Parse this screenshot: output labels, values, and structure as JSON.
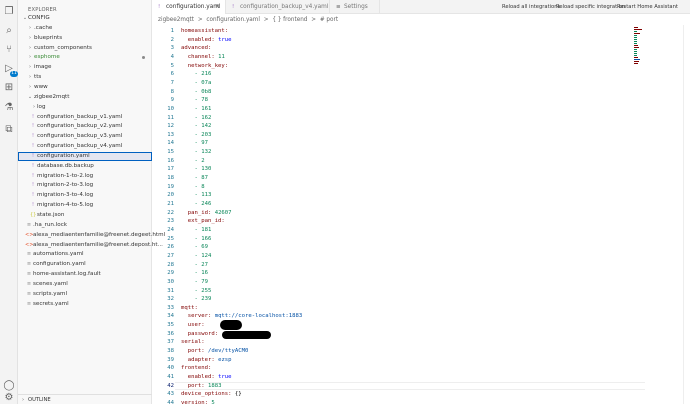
{
  "sidebar": {
    "title": "EXPLORER",
    "outline_label": "OUTLINE",
    "items": [
      {
        "label": "CONFIG",
        "type": "root"
      },
      {
        "label": ".cache",
        "type": "folder"
      },
      {
        "label": "blueprints",
        "type": "folder"
      },
      {
        "label": "custom_components",
        "type": "folder"
      },
      {
        "label": "esphome",
        "type": "folder-green"
      },
      {
        "label": "image",
        "type": "folder"
      },
      {
        "label": "tts",
        "type": "folder"
      },
      {
        "label": "www",
        "type": "folder"
      },
      {
        "label": "zigbee2mqtt",
        "type": "folder-open"
      },
      {
        "label": "log",
        "type": "subfolder"
      },
      {
        "label": "configuration_backup_v1.yaml",
        "type": "file"
      },
      {
        "label": "configuration_backup_v2.yaml",
        "type": "file"
      },
      {
        "label": "configuration_backup_v3.yaml",
        "type": "file"
      },
      {
        "label": "configuration_backup_v4.yaml",
        "type": "file"
      },
      {
        "label": "configuration.yaml",
        "type": "file-selected"
      },
      {
        "label": "database.db.backup",
        "type": "file"
      },
      {
        "label": "migration-1-to-2.log",
        "type": "file"
      },
      {
        "label": "migration-2-to-3.log",
        "type": "file"
      },
      {
        "label": "migration-3-to-4.log",
        "type": "file"
      },
      {
        "label": "migration-4-to-5.log",
        "type": "file"
      },
      {
        "label": "state.json",
        "type": "json"
      },
      {
        "label": ".ha_run.lock",
        "type": "rootfile"
      },
      {
        "label": "alexa_mediaentenfamilie@freenet.degeet.html",
        "type": "html"
      },
      {
        "label": "alexa_mediaentenfamilie@freenet.depost.ht...",
        "type": "html"
      },
      {
        "label": "automations.yaml",
        "type": "rootfile"
      },
      {
        "label": "configuration.yaml",
        "type": "rootfile"
      },
      {
        "label": "home-assistant.log.fault",
        "type": "rootfile"
      },
      {
        "label": "scenes.yaml",
        "type": "rootfile"
      },
      {
        "label": "scripts.yaml",
        "type": "rootfile"
      },
      {
        "label": "secrets.yaml",
        "type": "rootfile"
      }
    ]
  },
  "tabs": [
    {
      "label": "configuration.yaml",
      "active": true,
      "close": "×"
    },
    {
      "label": "configuration_backup_v4.yaml",
      "active": false,
      "close": ""
    },
    {
      "label": "Settings",
      "active": false,
      "close": ""
    }
  ],
  "header_actions": {
    "reload_all": "Reload all integrations",
    "reload_specific": "Reload specific integration",
    "restart": "Restart Home Assistant"
  },
  "breadcrumb": [
    "zigbee2mqtt",
    ">",
    "configuration.yaml",
    ">",
    "{ } frontend",
    ">",
    "# port"
  ],
  "editor": {
    "current_line": 42,
    "lines": [
      {
        "n": 1,
        "indent": "",
        "key": "homeassistant:",
        "val": "",
        "vtype": ""
      },
      {
        "n": 2,
        "indent": "  ",
        "key": "enabled:",
        "val": " true",
        "vtype": "b"
      },
      {
        "n": 3,
        "indent": "",
        "key": "advanced:",
        "val": "",
        "vtype": ""
      },
      {
        "n": 4,
        "indent": "  ",
        "key": "channel:",
        "val": " 11",
        "vtype": "n"
      },
      {
        "n": 5,
        "indent": "  ",
        "key": "network_key:",
        "val": "",
        "vtype": ""
      },
      {
        "n": 6,
        "indent": "    ",
        "key": "",
        "val": "- 216",
        "vtype": "n"
      },
      {
        "n": 7,
        "indent": "    ",
        "key": "",
        "val": "- 07a",
        "vtype": "n"
      },
      {
        "n": 8,
        "indent": "    ",
        "key": "",
        "val": "- 0b8",
        "vtype": "n"
      },
      {
        "n": 9,
        "indent": "    ",
        "key": "",
        "val": "- 78",
        "vtype": "n"
      },
      {
        "n": 10,
        "indent": "    ",
        "key": "",
        "val": "- 161",
        "vtype": "n"
      },
      {
        "n": 11,
        "indent": "    ",
        "key": "",
        "val": "- 162",
        "vtype": "n"
      },
      {
        "n": 12,
        "indent": "    ",
        "key": "",
        "val": "- 142",
        "vtype": "n"
      },
      {
        "n": 13,
        "indent": "    ",
        "key": "",
        "val": "- 203",
        "vtype": "n"
      },
      {
        "n": 14,
        "indent": "    ",
        "key": "",
        "val": "- 97",
        "vtype": "n"
      },
      {
        "n": 15,
        "indent": "    ",
        "key": "",
        "val": "- 132",
        "vtype": "n"
      },
      {
        "n": 16,
        "indent": "    ",
        "key": "",
        "val": "- 2",
        "vtype": "n"
      },
      {
        "n": 17,
        "indent": "    ",
        "key": "",
        "val": "- 130",
        "vtype": "n"
      },
      {
        "n": 18,
        "indent": "    ",
        "key": "",
        "val": "- 87",
        "vtype": "n"
      },
      {
        "n": 19,
        "indent": "    ",
        "key": "",
        "val": "- 8",
        "vtype": "n"
      },
      {
        "n": 20,
        "indent": "    ",
        "key": "",
        "val": "- 113",
        "vtype": "n"
      },
      {
        "n": 21,
        "indent": "    ",
        "key": "",
        "val": "- 246",
        "vtype": "n"
      },
      {
        "n": 22,
        "indent": "  ",
        "key": "pan_id:",
        "val": " 42607",
        "vtype": "n"
      },
      {
        "n": 23,
        "indent": "  ",
        "key": "ext_pan_id:",
        "val": "",
        "vtype": ""
      },
      {
        "n": 24,
        "indent": "    ",
        "key": "",
        "val": "- 181",
        "vtype": "n"
      },
      {
        "n": 25,
        "indent": "    ",
        "key": "",
        "val": "- 166",
        "vtype": "n"
      },
      {
        "n": 26,
        "indent": "    ",
        "key": "",
        "val": "- 69",
        "vtype": "n"
      },
      {
        "n": 27,
        "indent": "    ",
        "key": "",
        "val": "- 124",
        "vtype": "n"
      },
      {
        "n": 28,
        "indent": "    ",
        "key": "",
        "val": "- 27",
        "vtype": "n"
      },
      {
        "n": 29,
        "indent": "    ",
        "key": "",
        "val": "- 16",
        "vtype": "n"
      },
      {
        "n": 30,
        "indent": "    ",
        "key": "",
        "val": "- 79",
        "vtype": "n"
      },
      {
        "n": 31,
        "indent": "    ",
        "key": "",
        "val": "- 255",
        "vtype": "n"
      },
      {
        "n": 32,
        "indent": "    ",
        "key": "",
        "val": "- 239",
        "vtype": "n"
      },
      {
        "n": 33,
        "indent": "",
        "key": "mqtt:",
        "val": "",
        "vtype": ""
      },
      {
        "n": 34,
        "indent": "  ",
        "key": "server:",
        "val": " mqtt://core-localhost:1883",
        "vtype": "s"
      },
      {
        "n": 35,
        "indent": "  ",
        "key": "user:",
        "val": " ",
        "vtype": "s"
      },
      {
        "n": 36,
        "indent": "  ",
        "key": "password:",
        "val": " ",
        "vtype": "s"
      },
      {
        "n": 37,
        "indent": "",
        "key": "serial:",
        "val": "",
        "vtype": ""
      },
      {
        "n": 38,
        "indent": "  ",
        "key": "port:",
        "val": " /dev/ttyACM0",
        "vtype": "s"
      },
      {
        "n": 39,
        "indent": "  ",
        "key": "adapter:",
        "val": " ezsp",
        "vtype": "s"
      },
      {
        "n": 40,
        "indent": "",
        "key": "frontend:",
        "val": "",
        "vtype": ""
      },
      {
        "n": 41,
        "indent": "  ",
        "key": "enabled:",
        "val": " true",
        "vtype": "b"
      },
      {
        "n": 42,
        "indent": "  ",
        "key": "port:",
        "val": " 1883",
        "vtype": "n"
      },
      {
        "n": 43,
        "indent": "",
        "key": "device_options:",
        "val": " {}",
        "vtype": "p"
      },
      {
        "n": 44,
        "indent": "",
        "key": "version:",
        "val": " 5",
        "vtype": "n"
      }
    ]
  }
}
